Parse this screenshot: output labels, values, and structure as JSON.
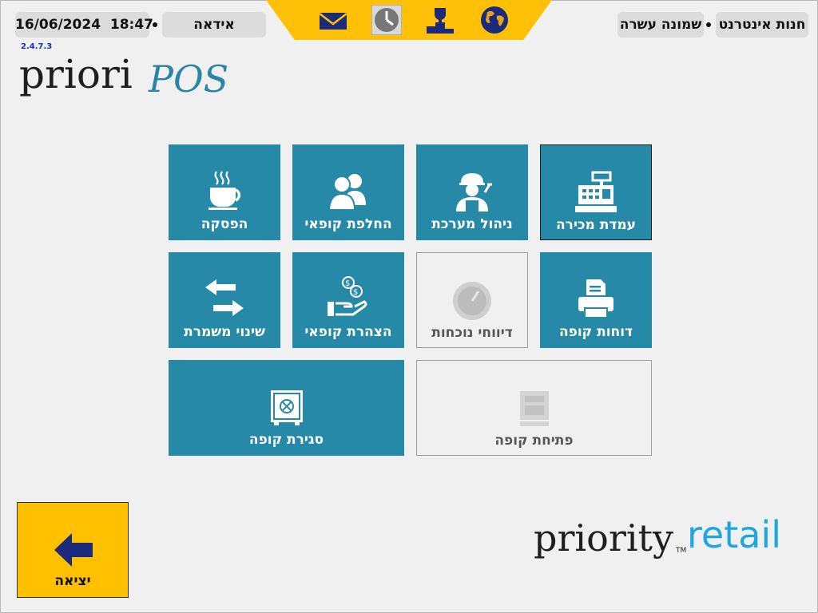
{
  "header": {
    "date": "16/06/2024",
    "time": "18:47",
    "user": "אידאה",
    "branch": "שמונה עשרה",
    "store": "חנות אינטרנט"
  },
  "toolbar": {
    "icons": [
      "mail-icon",
      "clock-icon",
      "trophy-podium-icon",
      "globe-icon"
    ]
  },
  "app": {
    "version": "2.4.7.3",
    "logo_word": "priori",
    "logo_suffix": "POS"
  },
  "tiles": [
    {
      "label": "הפסקה",
      "icon": "coffee-cup-icon",
      "enabled": true
    },
    {
      "label": "החלפת קופאי",
      "icon": "users-icon",
      "enabled": true
    },
    {
      "label": "ניהול מערכת",
      "icon": "technician-icon",
      "enabled": true
    },
    {
      "label": "עמדת מכירה",
      "icon": "cash-register-icon",
      "enabled": true,
      "selected": true
    },
    {
      "label": "שינוי משמרת",
      "icon": "swap-arrows-icon",
      "enabled": true
    },
    {
      "label": "הצהרת קופאי",
      "icon": "coins-hand-icon",
      "enabled": true
    },
    {
      "label": "דיווחי נוכחות",
      "icon": "clock-icon",
      "enabled": false
    },
    {
      "label": "דוחות קופה",
      "icon": "printer-icon",
      "enabled": true
    },
    {
      "label": "סגירת קופה",
      "icon": "safe-icon",
      "enabled": true
    },
    {
      "label": "פתיחת קופה",
      "icon": "cash-register-icon",
      "enabled": false
    }
  ],
  "exit": {
    "label": "יציאה"
  },
  "footer": {
    "logo_word": "priority",
    "logo_tm": "TM",
    "logo_suffix": "retail"
  },
  "colors": {
    "tile_active": "#2589a7",
    "accent_yellow": "#ffc107",
    "navy": "#1b2a7a",
    "retail_blue": "#1da7dc"
  }
}
